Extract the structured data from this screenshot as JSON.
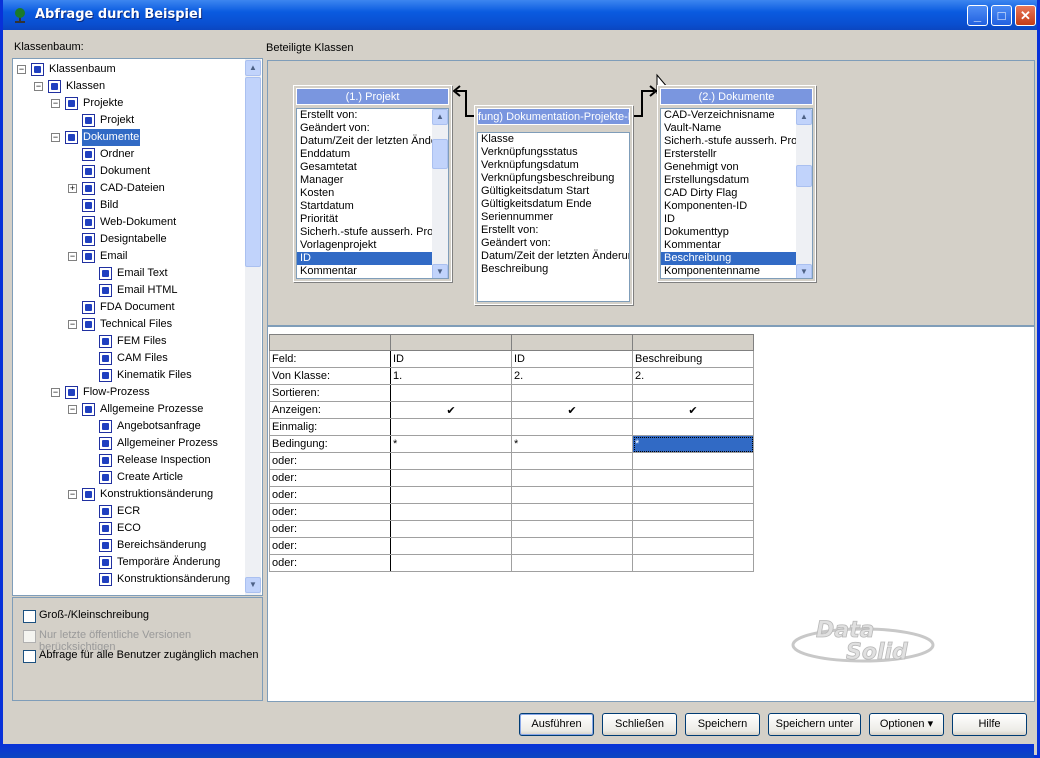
{
  "window": {
    "title": "Abfrage durch Beispiel",
    "controls": {
      "minimize": "_",
      "maximize": "□",
      "close": "✕"
    }
  },
  "labels": {
    "tree_label": "Klassenbaum:",
    "classes_label": "Beteiligte Klassen"
  },
  "tree": [
    {
      "label": "Klassenbaum",
      "level": 0,
      "expander": "−",
      "icon": "class-tree-root-icon"
    },
    {
      "label": "Klassen",
      "level": 1,
      "expander": "−",
      "icon": "class-icon"
    },
    {
      "label": "Projekte",
      "level": 2,
      "expander": "−",
      "icon": "class-icon"
    },
    {
      "label": "Projekt",
      "level": 3,
      "expander": "",
      "icon": "class-icon"
    },
    {
      "label": "Dokumente",
      "level": 2,
      "expander": "−",
      "icon": "class-icon",
      "selected": true
    },
    {
      "label": "Ordner",
      "level": 3,
      "expander": "",
      "icon": "class-icon"
    },
    {
      "label": "Dokument",
      "level": 3,
      "expander": "",
      "icon": "class-icon"
    },
    {
      "label": "CAD-Dateien",
      "level": 3,
      "expander": "+",
      "icon": "class-icon"
    },
    {
      "label": "Bild",
      "level": 3,
      "expander": "",
      "icon": "class-icon"
    },
    {
      "label": "Web-Dokument",
      "level": 3,
      "expander": "",
      "icon": "class-icon"
    },
    {
      "label": "Designtabelle",
      "level": 3,
      "expander": "",
      "icon": "class-icon"
    },
    {
      "label": "Email",
      "level": 3,
      "expander": "−",
      "icon": "class-icon"
    },
    {
      "label": "Email Text",
      "level": 4,
      "expander": "",
      "icon": "class-icon"
    },
    {
      "label": "Email HTML",
      "level": 4,
      "expander": "",
      "icon": "class-icon"
    },
    {
      "label": "FDA Document",
      "level": 3,
      "expander": "",
      "icon": "class-icon"
    },
    {
      "label": "Technical Files",
      "level": 3,
      "expander": "−",
      "icon": "class-icon"
    },
    {
      "label": "FEM Files",
      "level": 4,
      "expander": "",
      "icon": "class-icon"
    },
    {
      "label": "CAM Files",
      "level": 4,
      "expander": "",
      "icon": "class-icon"
    },
    {
      "label": "Kinematik Files",
      "level": 4,
      "expander": "",
      "icon": "class-icon"
    },
    {
      "label": "Flow-Prozess",
      "level": 2,
      "expander": "−",
      "icon": "class-icon"
    },
    {
      "label": "Allgemeine Prozesse",
      "level": 3,
      "expander": "−",
      "icon": "class-icon"
    },
    {
      "label": "Angebotsanfrage",
      "level": 4,
      "expander": "",
      "icon": "class-icon"
    },
    {
      "label": "Allgemeiner Prozess",
      "level": 4,
      "expander": "",
      "icon": "class-icon"
    },
    {
      "label": "Release Inspection",
      "level": 4,
      "expander": "",
      "icon": "class-icon"
    },
    {
      "label": "Create Article",
      "level": 4,
      "expander": "",
      "icon": "class-icon"
    },
    {
      "label": "Konstruktionsänderung",
      "level": 3,
      "expander": "−",
      "icon": "class-icon"
    },
    {
      "label": "ECR",
      "level": 4,
      "expander": "",
      "icon": "class-icon"
    },
    {
      "label": "ECO",
      "level": 4,
      "expander": "",
      "icon": "class-icon"
    },
    {
      "label": "Bereichsänderung",
      "level": 4,
      "expander": "",
      "icon": "class-icon"
    },
    {
      "label": "Temporäre Änderung",
      "level": 4,
      "expander": "",
      "icon": "class-icon"
    },
    {
      "label": "Konstruktionsänderung",
      "level": 4,
      "expander": "",
      "icon": "class-icon"
    }
  ],
  "options": {
    "case_sensitive": "Groß-/Kleinschreibung",
    "latest_public": "Nur letzte öffentliche Versionen berücksichtigen",
    "all_users": "Abfrage für alle Benutzer zugänglich machen"
  },
  "classes": [
    {
      "title": "(1.) Projekt",
      "items": [
        "Erstellt von:",
        "Geändert von:",
        "Datum/Zeit der letzten Änderung",
        "Enddatum",
        "Gesamtetat",
        "Manager",
        "Kosten",
        "Startdatum",
        "Priorität",
        "Sicherh.-stufe ausserh. Proz",
        "Vorlagenprojekt",
        "ID",
        "Kommentar"
      ],
      "selected": "ID"
    },
    {
      "title": "fung) Dokumentation-Projekte-B",
      "items": [
        "Klasse",
        "Verknüpfungsstatus",
        "Verknüpfungsdatum",
        "Verknüpfungsbeschreibung",
        "Gültigkeitsdatum Start",
        "Gültigkeitsdatum Ende",
        "Seriennummer",
        "Erstellt von:",
        "Geändert von:",
        "Datum/Zeit der letzten Änderung",
        "Beschreibung"
      ],
      "selected": ""
    },
    {
      "title": "(2.) Dokumente",
      "items": [
        "CAD-Verzeichnisname",
        "Vault-Name",
        "Sicherh.-stufe ausserh. Proz",
        "Ersterstellr",
        "Genehmigt von",
        "Erstellungsdatum",
        "CAD Dirty Flag",
        "Komponenten-ID",
        "ID",
        "Dokumenttyp",
        "Kommentar",
        "Beschreibung",
        "Komponentenname"
      ],
      "selected": "Beschreibung"
    }
  ],
  "grid": {
    "rows": [
      {
        "label": "Feld:",
        "cells": [
          "ID",
          "ID",
          "Beschreibung"
        ]
      },
      {
        "label": "Von Klasse:",
        "cells": [
          "1.",
          "2.",
          "2."
        ]
      },
      {
        "label": "Sortieren:",
        "cells": [
          "",
          "",
          ""
        ]
      },
      {
        "label": "Anzeigen:",
        "cells": [
          "✔",
          "✔",
          "✔"
        ]
      },
      {
        "label": "Einmalig:",
        "cells": [
          "",
          "",
          ""
        ]
      },
      {
        "label": "Bedingung:",
        "cells": [
          "*",
          "*",
          "*"
        ]
      },
      {
        "label": "oder:",
        "cells": [
          "",
          "",
          ""
        ]
      },
      {
        "label": "oder:",
        "cells": [
          "",
          "",
          ""
        ]
      },
      {
        "label": "oder:",
        "cells": [
          "",
          "",
          ""
        ]
      },
      {
        "label": "oder:",
        "cells": [
          "",
          "",
          ""
        ]
      },
      {
        "label": "oder:",
        "cells": [
          "",
          "",
          ""
        ]
      },
      {
        "label": "oder:",
        "cells": [
          "",
          "",
          ""
        ]
      },
      {
        "label": "oder:",
        "cells": [
          "",
          "",
          ""
        ]
      }
    ]
  },
  "logo_text": "Data Solid",
  "buttons": {
    "run": "Ausführen",
    "close": "Schließen",
    "save": "Speichern",
    "save_as": "Speichern unter",
    "options": "Optionen ▾",
    "help": "Hilfe"
  },
  "colors": {
    "selection": "#316ac5",
    "title_bar": "#0a5be0",
    "class_header": "#7a96df"
  }
}
